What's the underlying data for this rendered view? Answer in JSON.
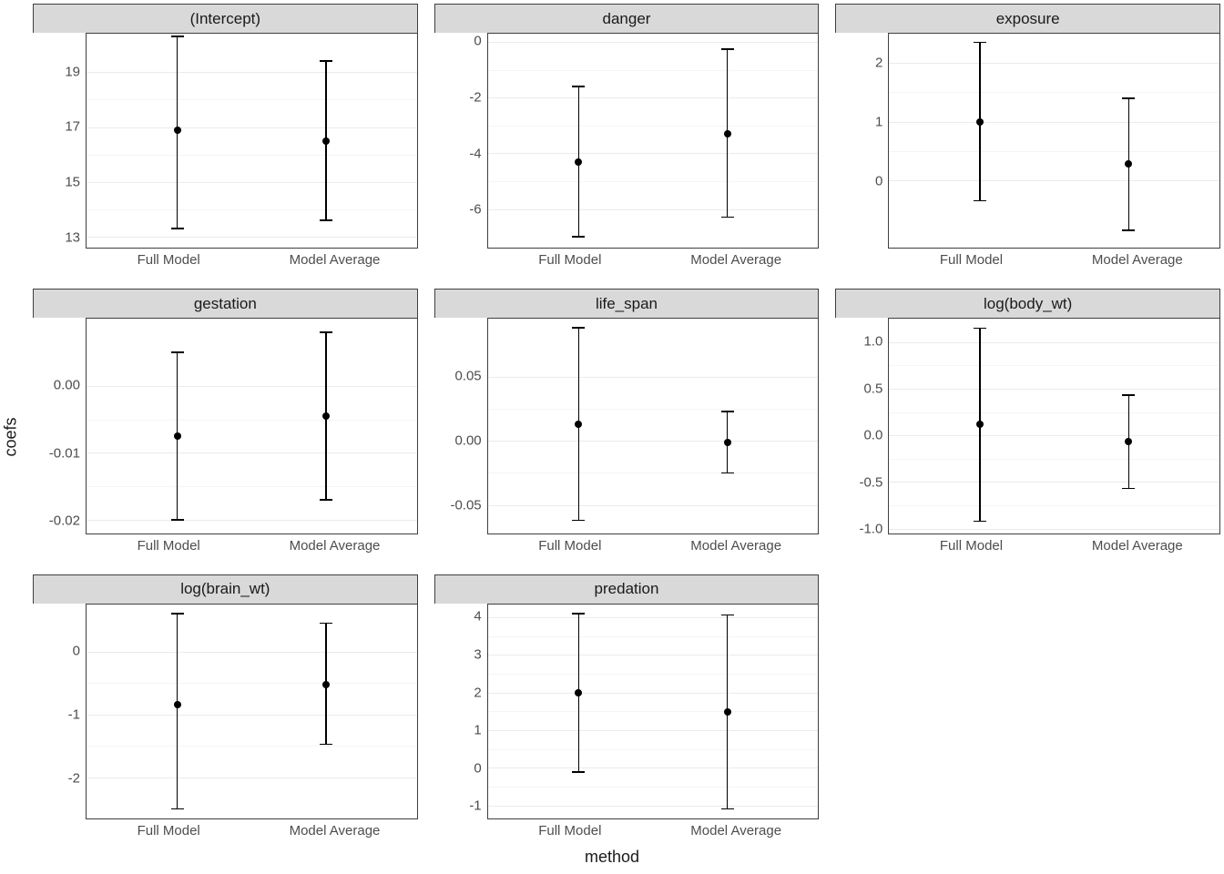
{
  "axis_labels": {
    "x": "method",
    "y": "coefs"
  },
  "x_categories": [
    "Full Model",
    "Model Average"
  ],
  "chart_data": [
    {
      "facet": "(Intercept)",
      "ylim": [
        12.6,
        20.4
      ],
      "yticks": [
        13,
        15,
        17,
        19
      ],
      "points": [
        {
          "x": "Full Model",
          "y": 16.9,
          "lo": 13.3,
          "hi": 20.3
        },
        {
          "x": "Model Average",
          "y": 16.5,
          "lo": 13.6,
          "hi": 19.4
        }
      ]
    },
    {
      "facet": "danger",
      "ylim": [
        -7.4,
        0.3
      ],
      "yticks": [
        -6,
        -4,
        -2,
        0
      ],
      "points": [
        {
          "x": "Full Model",
          "y": -4.3,
          "lo": -7.0,
          "hi": -1.6
        },
        {
          "x": "Model Average",
          "y": -3.3,
          "lo": -6.3,
          "hi": -0.25
        }
      ]
    },
    {
      "facet": "exposure",
      "ylim": [
        -1.15,
        2.5
      ],
      "yticks": [
        0,
        1,
        2
      ],
      "points": [
        {
          "x": "Full Model",
          "y": 1.0,
          "lo": -0.35,
          "hi": 2.35
        },
        {
          "x": "Model Average",
          "y": 0.28,
          "lo": -0.85,
          "hi": 1.4
        }
      ]
    },
    {
      "facet": "gestation",
      "ylim": [
        -0.022,
        0.01
      ],
      "yticks": [
        -0.02,
        -0.01,
        0.0
      ],
      "ytick_labels": [
        "-0.02",
        "-0.01",
        "0.00"
      ],
      "points": [
        {
          "x": "Full Model",
          "y": -0.0075,
          "lo": -0.02,
          "hi": 0.005
        },
        {
          "x": "Model Average",
          "y": -0.0045,
          "lo": -0.017,
          "hi": 0.008
        }
      ]
    },
    {
      "facet": "life_span",
      "ylim": [
        -0.072,
        0.095
      ],
      "yticks": [
        -0.05,
        0.0,
        0.05
      ],
      "ytick_labels": [
        "-0.05",
        "0.00",
        "0.05"
      ],
      "points": [
        {
          "x": "Full Model",
          "y": 0.013,
          "lo": -0.062,
          "hi": 0.088
        },
        {
          "x": "Model Average",
          "y": -0.001,
          "lo": -0.025,
          "hi": 0.023
        }
      ]
    },
    {
      "facet": "log(body_wt)",
      "ylim": [
        -1.05,
        1.25
      ],
      "yticks": [
        -1.0,
        -0.5,
        0.0,
        0.5,
        1.0
      ],
      "ytick_labels": [
        "-1.0",
        "-0.5",
        "0.0",
        "0.5",
        "1.0"
      ],
      "points": [
        {
          "x": "Full Model",
          "y": 0.12,
          "lo": -0.92,
          "hi": 1.15
        },
        {
          "x": "Model Average",
          "y": -0.07,
          "lo": -0.57,
          "hi": 0.43
        }
      ]
    },
    {
      "facet": "log(brain_wt)",
      "ylim": [
        -2.65,
        0.75
      ],
      "yticks": [
        -2,
        -1,
        0
      ],
      "points": [
        {
          "x": "Full Model",
          "y": -0.85,
          "lo": -2.5,
          "hi": 0.6
        },
        {
          "x": "Model Average",
          "y": -0.52,
          "lo": -1.47,
          "hi": 0.45
        }
      ]
    },
    {
      "facet": "predation",
      "ylim": [
        -1.35,
        4.35
      ],
      "yticks": [
        -1,
        0,
        1,
        2,
        3,
        4
      ],
      "points": [
        {
          "x": "Full Model",
          "y": 2.0,
          "lo": -0.12,
          "hi": 4.1
        },
        {
          "x": "Model Average",
          "y": 1.48,
          "lo": -1.1,
          "hi": 4.06
        }
      ]
    }
  ]
}
